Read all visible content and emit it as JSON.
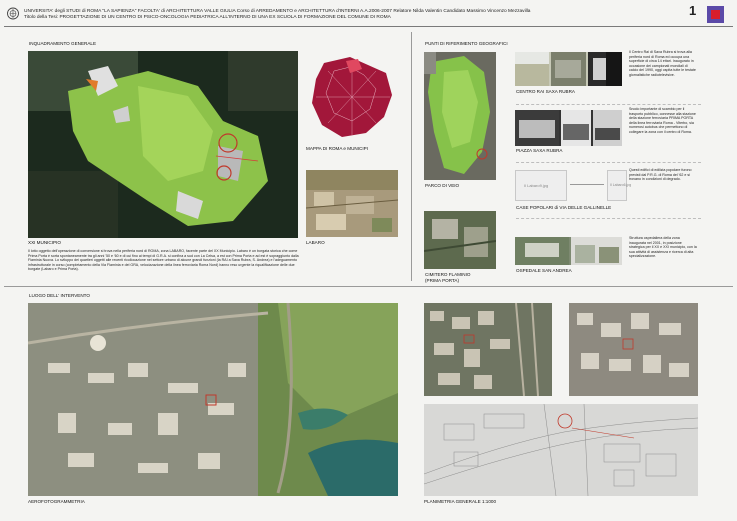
{
  "header": {
    "line1": "UNIVERSITA' degli STUDI di ROMA \"LA SAPIENZA\" FACOLTA' di ARCHITETTURA VALLE GIULIA Corso di ARREDAMENTO e ARCHITETTURA d'INTERNI  A.A.2006-2007    Relatore Nilda Valentin  Candidato Massimo Vincenzo Mezzavilla",
    "line2": "Titolo della Tesi: PROGETTAZIONE DI UN CENTRO DI PSICO-ONCOLOGIA PEDIATRICA ALL'INTERNO DI UNA EX SCUOLA DI FORMAZIONE DEL COMUNE DI ROMA",
    "sheet_number": "1",
    "brand_color": "#5b4aa8",
    "accent_color": "#d81e2c"
  },
  "sections": {
    "inquadramento": "INQUADRAMENTO GENERALE",
    "punti": "PUNTI DI RIFERIMENTO GEOGRAFICI",
    "luogo": "LUOGO DELL' INTERVENTO"
  },
  "captions": {
    "municipio": "XXI MUNICIPIO",
    "mappa_roma": "MAPPA DI ROMA e MUNICIPI",
    "labaro": "LABARO",
    "parco_veio": "PARCO DI VEIO",
    "cimitero": "CIMITERO FLAMINIO\n(PRIMA PORTA)",
    "centro_rai": "CENTRO RAI SAXA RUBRA",
    "piazza_saxa": "PIAZZA SAXA RUBRA",
    "casette": "CASE POPOLARI di VIA DELLE GALLINELLE",
    "ospedale": "OSPEDALE SAN ANDREA",
    "aerofoto": "AEROFOTOGRAMMETRIA",
    "planimetria": "PLANIMETRIA GENERALE 1:1000"
  },
  "texts": {
    "municipio_desc": "Il lotto oggetto dell'operazione di conversione si trova nella periferia nord di ROMA, zona LABARO, facente parte del XX Municipio. Labaro è un borgata storica che come Prima Porta è sorta spontaneamente tra gli anni '50 e '60 e di cui fino ai tempi di G.R.A. si confina a sud con La Celsa, a est con Prima Porta e ad est è sopraggiunto dalla Flaminia Nuova. Lo sviluppo dei quartieri oggetti alle recenti ricollocazione nel settore urbano di alcune grandi funzioni (la RAI a Saxa Rubra, S. Andrea) e l'adeguamento infrastrutturale in corso (completamento della Via Flaminia e del GRA, velocizzazione della linea ferroviaria Roma Nord) hanno reso urgente la riqualificazione delle due borgate (Labaro e Prima Porta).",
    "rai_desc": "Il Centro Rai di Saxa Rubra si trova alla periferia nord di Roma ed occupa una superficie di circa 14 ettari. Inaugurato in occasione dei campionati mondiali di calcio del 1990, oggi ospita tutte le testate giornalistiche radiotelevisive.",
    "piazza_desc": "Snodo importante di scambio per il trasporto pubblico, connesse alla stazione della stazione ferroviaria PRIMA PORTA della linea ferroviaria Roma - Viterbo, sia numerosi autobus che permettono di collegare la zona con il centro di Roma.",
    "casette_desc": "Questi edifici di edilizia popolare furono previsti dal P.R.G. di Roma del '62 e si trovano in condizioni di degrado.",
    "ospedale_desc": "Struttura ospedaliera della zona inaugurata nel 2001, in posizione strategica per il XX e XXI municipio, con la sua attività di assistenza e ricerca di alta specializzazione."
  },
  "placeholders": {
    "casette_left": "Il Labaro9.jpg",
    "casette_right": "Il Labaro6.jpg"
  }
}
